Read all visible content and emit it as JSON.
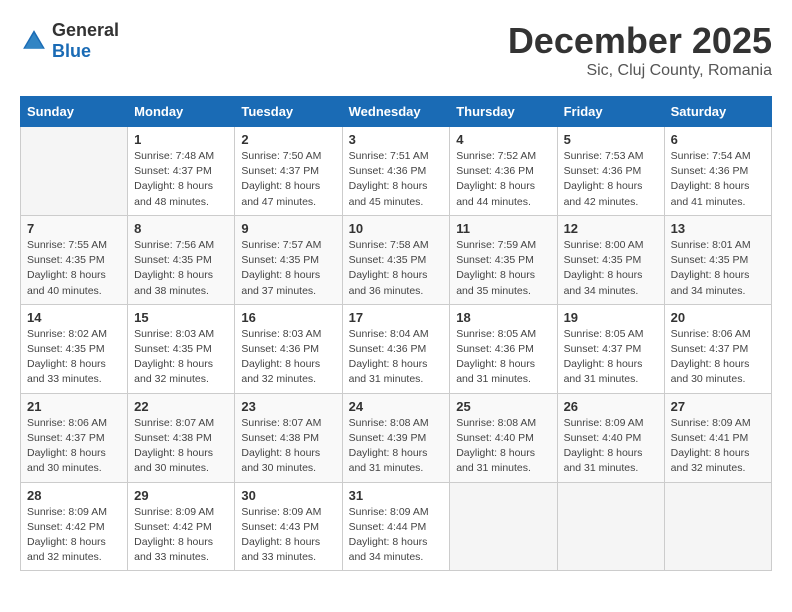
{
  "logo": {
    "general": "General",
    "blue": "Blue"
  },
  "title": "December 2025",
  "location": "Sic, Cluj County, Romania",
  "days_of_week": [
    "Sunday",
    "Monday",
    "Tuesday",
    "Wednesday",
    "Thursday",
    "Friday",
    "Saturday"
  ],
  "weeks": [
    [
      {
        "day": "",
        "info": ""
      },
      {
        "day": "1",
        "info": "Sunrise: 7:48 AM\nSunset: 4:37 PM\nDaylight: 8 hours\nand 48 minutes."
      },
      {
        "day": "2",
        "info": "Sunrise: 7:50 AM\nSunset: 4:37 PM\nDaylight: 8 hours\nand 47 minutes."
      },
      {
        "day": "3",
        "info": "Sunrise: 7:51 AM\nSunset: 4:36 PM\nDaylight: 8 hours\nand 45 minutes."
      },
      {
        "day": "4",
        "info": "Sunrise: 7:52 AM\nSunset: 4:36 PM\nDaylight: 8 hours\nand 44 minutes."
      },
      {
        "day": "5",
        "info": "Sunrise: 7:53 AM\nSunset: 4:36 PM\nDaylight: 8 hours\nand 42 minutes."
      },
      {
        "day": "6",
        "info": "Sunrise: 7:54 AM\nSunset: 4:36 PM\nDaylight: 8 hours\nand 41 minutes."
      }
    ],
    [
      {
        "day": "7",
        "info": "Sunrise: 7:55 AM\nSunset: 4:35 PM\nDaylight: 8 hours\nand 40 minutes."
      },
      {
        "day": "8",
        "info": "Sunrise: 7:56 AM\nSunset: 4:35 PM\nDaylight: 8 hours\nand 38 minutes."
      },
      {
        "day": "9",
        "info": "Sunrise: 7:57 AM\nSunset: 4:35 PM\nDaylight: 8 hours\nand 37 minutes."
      },
      {
        "day": "10",
        "info": "Sunrise: 7:58 AM\nSunset: 4:35 PM\nDaylight: 8 hours\nand 36 minutes."
      },
      {
        "day": "11",
        "info": "Sunrise: 7:59 AM\nSunset: 4:35 PM\nDaylight: 8 hours\nand 35 minutes."
      },
      {
        "day": "12",
        "info": "Sunrise: 8:00 AM\nSunset: 4:35 PM\nDaylight: 8 hours\nand 34 minutes."
      },
      {
        "day": "13",
        "info": "Sunrise: 8:01 AM\nSunset: 4:35 PM\nDaylight: 8 hours\nand 34 minutes."
      }
    ],
    [
      {
        "day": "14",
        "info": "Sunrise: 8:02 AM\nSunset: 4:35 PM\nDaylight: 8 hours\nand 33 minutes."
      },
      {
        "day": "15",
        "info": "Sunrise: 8:03 AM\nSunset: 4:35 PM\nDaylight: 8 hours\nand 32 minutes."
      },
      {
        "day": "16",
        "info": "Sunrise: 8:03 AM\nSunset: 4:36 PM\nDaylight: 8 hours\nand 32 minutes."
      },
      {
        "day": "17",
        "info": "Sunrise: 8:04 AM\nSunset: 4:36 PM\nDaylight: 8 hours\nand 31 minutes."
      },
      {
        "day": "18",
        "info": "Sunrise: 8:05 AM\nSunset: 4:36 PM\nDaylight: 8 hours\nand 31 minutes."
      },
      {
        "day": "19",
        "info": "Sunrise: 8:05 AM\nSunset: 4:37 PM\nDaylight: 8 hours\nand 31 minutes."
      },
      {
        "day": "20",
        "info": "Sunrise: 8:06 AM\nSunset: 4:37 PM\nDaylight: 8 hours\nand 30 minutes."
      }
    ],
    [
      {
        "day": "21",
        "info": "Sunrise: 8:06 AM\nSunset: 4:37 PM\nDaylight: 8 hours\nand 30 minutes."
      },
      {
        "day": "22",
        "info": "Sunrise: 8:07 AM\nSunset: 4:38 PM\nDaylight: 8 hours\nand 30 minutes."
      },
      {
        "day": "23",
        "info": "Sunrise: 8:07 AM\nSunset: 4:38 PM\nDaylight: 8 hours\nand 30 minutes."
      },
      {
        "day": "24",
        "info": "Sunrise: 8:08 AM\nSunset: 4:39 PM\nDaylight: 8 hours\nand 31 minutes."
      },
      {
        "day": "25",
        "info": "Sunrise: 8:08 AM\nSunset: 4:40 PM\nDaylight: 8 hours\nand 31 minutes."
      },
      {
        "day": "26",
        "info": "Sunrise: 8:09 AM\nSunset: 4:40 PM\nDaylight: 8 hours\nand 31 minutes."
      },
      {
        "day": "27",
        "info": "Sunrise: 8:09 AM\nSunset: 4:41 PM\nDaylight: 8 hours\nand 32 minutes."
      }
    ],
    [
      {
        "day": "28",
        "info": "Sunrise: 8:09 AM\nSunset: 4:42 PM\nDaylight: 8 hours\nand 32 minutes."
      },
      {
        "day": "29",
        "info": "Sunrise: 8:09 AM\nSunset: 4:42 PM\nDaylight: 8 hours\nand 33 minutes."
      },
      {
        "day": "30",
        "info": "Sunrise: 8:09 AM\nSunset: 4:43 PM\nDaylight: 8 hours\nand 33 minutes."
      },
      {
        "day": "31",
        "info": "Sunrise: 8:09 AM\nSunset: 4:44 PM\nDaylight: 8 hours\nand 34 minutes."
      },
      {
        "day": "",
        "info": ""
      },
      {
        "day": "",
        "info": ""
      },
      {
        "day": "",
        "info": ""
      }
    ]
  ]
}
